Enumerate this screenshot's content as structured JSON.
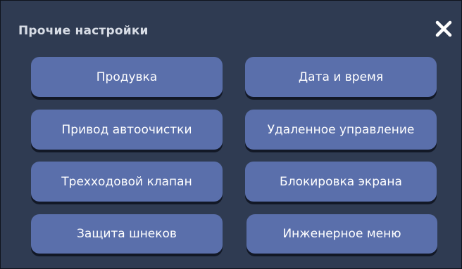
{
  "dialog": {
    "title": "Прочие настройки",
    "close_icon": "close-icon"
  },
  "buttons": [
    {
      "label": "Продувка"
    },
    {
      "label": "Дата и время"
    },
    {
      "label": "Привод автоочистки"
    },
    {
      "label": "Удаленное управление"
    },
    {
      "label": "Трехходовой клапан"
    },
    {
      "label": "Блокировка экрана"
    },
    {
      "label": "Защита шнеков"
    },
    {
      "label": "Инженерное меню"
    }
  ],
  "colors": {
    "panel_background": "#2f3b52",
    "button_background": "#5a6fab",
    "button_text": "#ffffff",
    "title_text": "#d8dde6"
  }
}
